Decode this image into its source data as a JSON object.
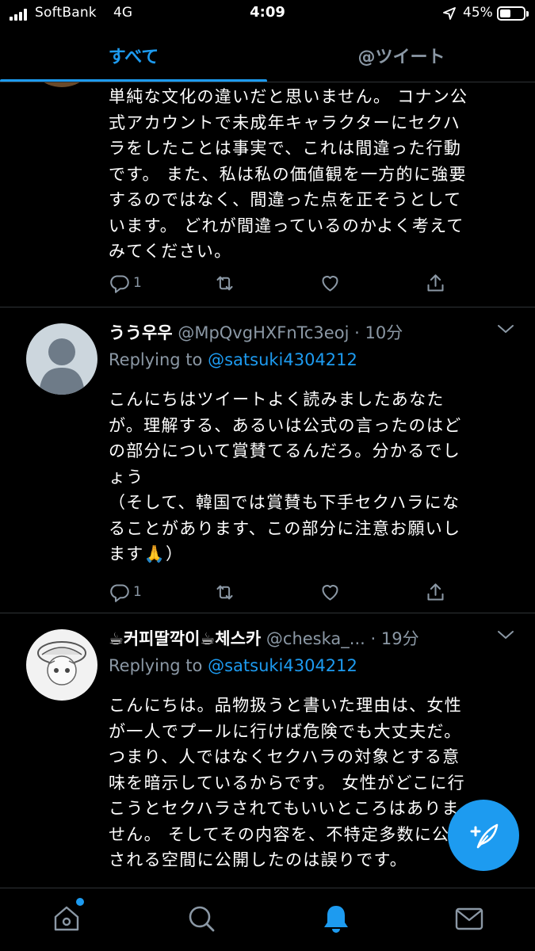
{
  "status_bar": {
    "carrier": "SoftBank",
    "network": "4G",
    "time": "4:09",
    "battery": "45%",
    "battery_level": 0.45,
    "icons": [
      "signal-icon",
      "location-arrow-icon",
      "battery-icon"
    ]
  },
  "tabs": [
    {
      "label": "すべて",
      "active": true
    },
    {
      "label": "@ツイート",
      "active": false
    }
  ],
  "tweets": [
    {
      "body_lines": [
        "単純な文化の違いだと思いません。 コナン公",
        "式アカウントで未成年キャラクターにセクハ",
        "ラをしたことは事実で、これは間違った行動",
        "です。 また、私は私の価値観を一方的に強要",
        "するのではなく、間違った点を正そうとして",
        "います。 どれが間違っているのかよく考えて",
        "みてください。"
      ],
      "reply_count": "1"
    },
    {
      "name": "うう우우",
      "handle": "@MpQvgHXFnTc3eoj",
      "dot": "·",
      "time": "10分",
      "replying_prefix": "Replying to ",
      "replying_to": "@satsuki4304212",
      "body_lines": [
        "こんにちはツイートよく読みましたあなた",
        "が。理解する、あるいは公式の言ったのはど",
        "の部分について賞賛てるんだろ。分かるでし",
        "ょう",
        "（そして、韓国では賞賛も下手セクハラにな",
        "ることがあります、この部分に注意お願いし",
        "ます🙏）"
      ],
      "reply_count": "1"
    },
    {
      "name": "☕커피딸깍이☕체스카",
      "handle": "@cheska_...",
      "dot": "·",
      "time": "19分",
      "replying_prefix": "Replying to ",
      "replying_to": "@satsuki4304212",
      "body_lines": [
        "こんにちは。品物扱うと書いた理由は、女性",
        "が一人でプールに行けば危険でも大丈夫だ。",
        "つまり、人ではなくセクハラの対象とする意",
        "味を暗示しているからです。 女性がどこに行",
        "こうとセクハラされてもいいところはありま",
        "せん。 そしてその内容を、不特定多数に公開",
        "される空間に公開したのは誤りです。"
      ]
    }
  ],
  "fab": {
    "icon": "compose-feather-icon"
  },
  "bottom_nav": [
    {
      "icon": "home-icon",
      "has_dot": true
    },
    {
      "icon": "search-icon"
    },
    {
      "icon": "notifications-bell-icon",
      "active": true
    },
    {
      "icon": "messages-envelope-icon"
    }
  ],
  "colors": {
    "accent": "#1d9bf0",
    "background": "#000000",
    "text": "#ffffff",
    "secondary_text": "#8b98a5",
    "divider": "#2f3336"
  }
}
